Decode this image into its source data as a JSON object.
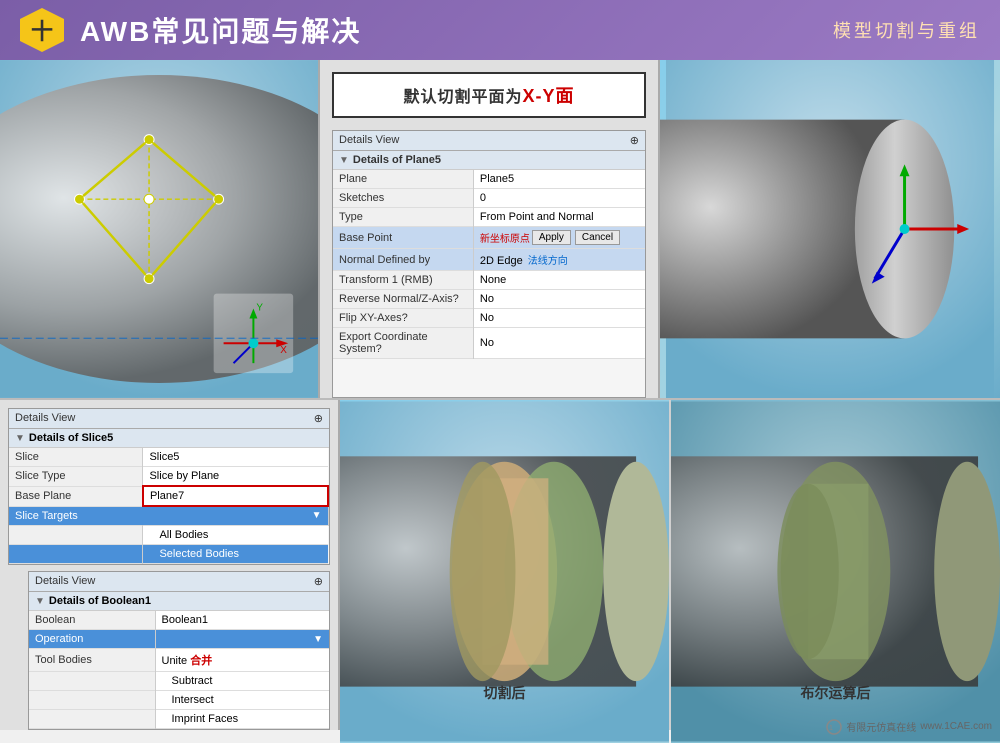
{
  "header": {
    "icon": "十",
    "title": "AWB常见问题与解决",
    "subtitle": "模型切割与重组"
  },
  "topCenter": {
    "titleBox": {
      "prefix": "默认切割平面为",
      "highlight": "X-Y面"
    },
    "detailsPanel": {
      "header": "Details View",
      "pin": "⊕",
      "sectionTitle": "Details of Plane5",
      "rows": [
        {
          "label": "Plane",
          "value": "Plane5",
          "highlight": ""
        },
        {
          "label": "Sketches",
          "value": "0",
          "highlight": ""
        },
        {
          "label": "Type",
          "value": "From Point and Normal",
          "highlight": ""
        },
        {
          "label": "Base Point",
          "value": "新坐标原点",
          "highlight": "blue",
          "hasButtons": true
        },
        {
          "label": "Normal Defined by",
          "value": "2D Edge",
          "highlight": "blue",
          "chineseLabel": "法线方向"
        },
        {
          "label": "Transform 1 (RMB)",
          "value": "None",
          "highlight": ""
        },
        {
          "label": "Reverse Normal/Z-Axis?",
          "value": "No",
          "highlight": ""
        },
        {
          "label": "Flip XY-Axes?",
          "value": "No",
          "highlight": ""
        },
        {
          "label": "Export Coordinate System?",
          "value": "No",
          "highlight": ""
        }
      ],
      "applyLabel": "Apply",
      "cancelLabel": "Cancel"
    }
  },
  "bottomLeft": {
    "slicePanel": {
      "header": "Details View",
      "pin": "⊕",
      "sectionTitle": "Details of Slice5",
      "rows": [
        {
          "label": "Slice",
          "value": "Slice5",
          "highlight": ""
        },
        {
          "label": "Slice Type",
          "value": "Slice by Plane",
          "highlight": ""
        },
        {
          "label": "Base Plane",
          "value": "Plane7",
          "highlight": "red"
        },
        {
          "label": "Slice Targets",
          "value": "",
          "highlight": "blue-header",
          "hasDropdown": true
        },
        {
          "label": "",
          "value": "All Bodies",
          "indent": true,
          "highlight": ""
        },
        {
          "label": "",
          "value": "Selected Bodies",
          "indent": true,
          "highlight": "selected"
        }
      ]
    },
    "booleanPanel": {
      "header": "Details View",
      "pin": "⊕",
      "sectionTitle": "Details of Boolean1",
      "rows": [
        {
          "label": "Boolean",
          "value": "Boolean1",
          "highlight": ""
        },
        {
          "label": "Operation",
          "value": "",
          "highlight": "blue-header"
        },
        {
          "label": "Tool Bodies",
          "value": "Unite",
          "chineseLabel": "合并",
          "highlight": ""
        },
        {
          "label": "",
          "value": "Subtract",
          "indent": true,
          "highlight": ""
        },
        {
          "label": "",
          "value": "Intersect",
          "indent": true,
          "highlight": ""
        },
        {
          "label": "",
          "value": "Imprint Faces",
          "indent": true,
          "highlight": ""
        }
      ]
    }
  },
  "bottomRight": {
    "afterCutLabel": "切割后",
    "afterBooleanLabel": "布尔运算后"
  },
  "watermark": {
    "text": "www.1CAE.com",
    "logoText": "有限元仿真在线"
  }
}
